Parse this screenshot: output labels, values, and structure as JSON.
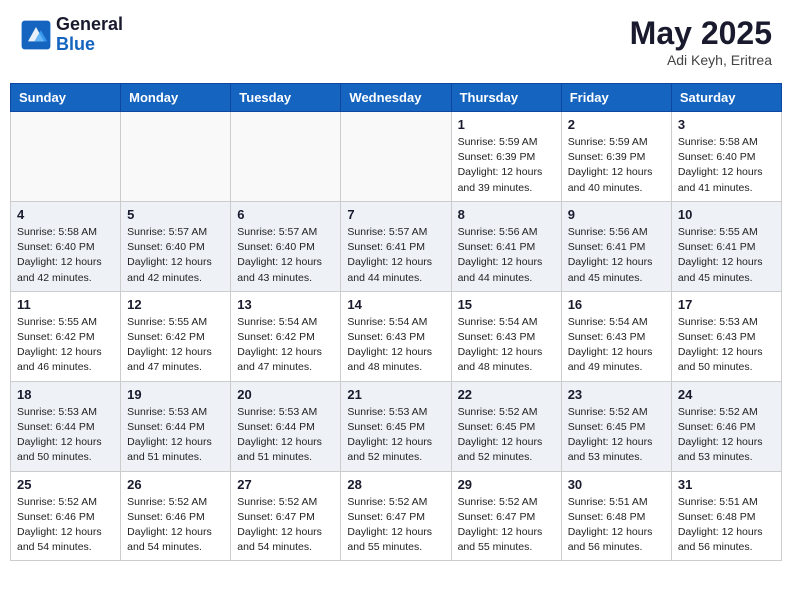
{
  "header": {
    "logo_line1": "General",
    "logo_line2": "Blue",
    "month_year": "May 2025",
    "location": "Adi Keyh, Eritrea"
  },
  "weekdays": [
    "Sunday",
    "Monday",
    "Tuesday",
    "Wednesday",
    "Thursday",
    "Friday",
    "Saturday"
  ],
  "weeks": [
    [
      {
        "day": "",
        "info": ""
      },
      {
        "day": "",
        "info": ""
      },
      {
        "day": "",
        "info": ""
      },
      {
        "day": "",
        "info": ""
      },
      {
        "day": "1",
        "info": "Sunrise: 5:59 AM\nSunset: 6:39 PM\nDaylight: 12 hours\nand 39 minutes."
      },
      {
        "day": "2",
        "info": "Sunrise: 5:59 AM\nSunset: 6:39 PM\nDaylight: 12 hours\nand 40 minutes."
      },
      {
        "day": "3",
        "info": "Sunrise: 5:58 AM\nSunset: 6:40 PM\nDaylight: 12 hours\nand 41 minutes."
      }
    ],
    [
      {
        "day": "4",
        "info": "Sunrise: 5:58 AM\nSunset: 6:40 PM\nDaylight: 12 hours\nand 42 minutes."
      },
      {
        "day": "5",
        "info": "Sunrise: 5:57 AM\nSunset: 6:40 PM\nDaylight: 12 hours\nand 42 minutes."
      },
      {
        "day": "6",
        "info": "Sunrise: 5:57 AM\nSunset: 6:40 PM\nDaylight: 12 hours\nand 43 minutes."
      },
      {
        "day": "7",
        "info": "Sunrise: 5:57 AM\nSunset: 6:41 PM\nDaylight: 12 hours\nand 44 minutes."
      },
      {
        "day": "8",
        "info": "Sunrise: 5:56 AM\nSunset: 6:41 PM\nDaylight: 12 hours\nand 44 minutes."
      },
      {
        "day": "9",
        "info": "Sunrise: 5:56 AM\nSunset: 6:41 PM\nDaylight: 12 hours\nand 45 minutes."
      },
      {
        "day": "10",
        "info": "Sunrise: 5:55 AM\nSunset: 6:41 PM\nDaylight: 12 hours\nand 45 minutes."
      }
    ],
    [
      {
        "day": "11",
        "info": "Sunrise: 5:55 AM\nSunset: 6:42 PM\nDaylight: 12 hours\nand 46 minutes."
      },
      {
        "day": "12",
        "info": "Sunrise: 5:55 AM\nSunset: 6:42 PM\nDaylight: 12 hours\nand 47 minutes."
      },
      {
        "day": "13",
        "info": "Sunrise: 5:54 AM\nSunset: 6:42 PM\nDaylight: 12 hours\nand 47 minutes."
      },
      {
        "day": "14",
        "info": "Sunrise: 5:54 AM\nSunset: 6:43 PM\nDaylight: 12 hours\nand 48 minutes."
      },
      {
        "day": "15",
        "info": "Sunrise: 5:54 AM\nSunset: 6:43 PM\nDaylight: 12 hours\nand 48 minutes."
      },
      {
        "day": "16",
        "info": "Sunrise: 5:54 AM\nSunset: 6:43 PM\nDaylight: 12 hours\nand 49 minutes."
      },
      {
        "day": "17",
        "info": "Sunrise: 5:53 AM\nSunset: 6:43 PM\nDaylight: 12 hours\nand 50 minutes."
      }
    ],
    [
      {
        "day": "18",
        "info": "Sunrise: 5:53 AM\nSunset: 6:44 PM\nDaylight: 12 hours\nand 50 minutes."
      },
      {
        "day": "19",
        "info": "Sunrise: 5:53 AM\nSunset: 6:44 PM\nDaylight: 12 hours\nand 51 minutes."
      },
      {
        "day": "20",
        "info": "Sunrise: 5:53 AM\nSunset: 6:44 PM\nDaylight: 12 hours\nand 51 minutes."
      },
      {
        "day": "21",
        "info": "Sunrise: 5:53 AM\nSunset: 6:45 PM\nDaylight: 12 hours\nand 52 minutes."
      },
      {
        "day": "22",
        "info": "Sunrise: 5:52 AM\nSunset: 6:45 PM\nDaylight: 12 hours\nand 52 minutes."
      },
      {
        "day": "23",
        "info": "Sunrise: 5:52 AM\nSunset: 6:45 PM\nDaylight: 12 hours\nand 53 minutes."
      },
      {
        "day": "24",
        "info": "Sunrise: 5:52 AM\nSunset: 6:46 PM\nDaylight: 12 hours\nand 53 minutes."
      }
    ],
    [
      {
        "day": "25",
        "info": "Sunrise: 5:52 AM\nSunset: 6:46 PM\nDaylight: 12 hours\nand 54 minutes."
      },
      {
        "day": "26",
        "info": "Sunrise: 5:52 AM\nSunset: 6:46 PM\nDaylight: 12 hours\nand 54 minutes."
      },
      {
        "day": "27",
        "info": "Sunrise: 5:52 AM\nSunset: 6:47 PM\nDaylight: 12 hours\nand 54 minutes."
      },
      {
        "day": "28",
        "info": "Sunrise: 5:52 AM\nSunset: 6:47 PM\nDaylight: 12 hours\nand 55 minutes."
      },
      {
        "day": "29",
        "info": "Sunrise: 5:52 AM\nSunset: 6:47 PM\nDaylight: 12 hours\nand 55 minutes."
      },
      {
        "day": "30",
        "info": "Sunrise: 5:51 AM\nSunset: 6:48 PM\nDaylight: 12 hours\nand 56 minutes."
      },
      {
        "day": "31",
        "info": "Sunrise: 5:51 AM\nSunset: 6:48 PM\nDaylight: 12 hours\nand 56 minutes."
      }
    ]
  ],
  "alt_rows": [
    1,
    3
  ]
}
